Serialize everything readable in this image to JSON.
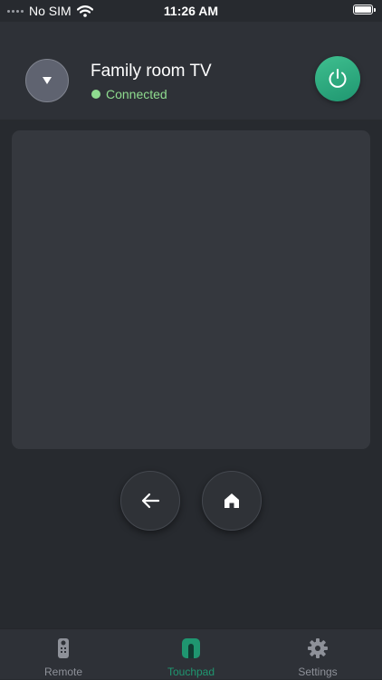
{
  "status_bar": {
    "carrier": "No SIM",
    "time": "11:26 AM"
  },
  "header": {
    "device_name": "Family room TV",
    "connection_status": "Connected"
  },
  "controls": {
    "back_icon": "arrow-left-icon",
    "home_icon": "home-icon"
  },
  "tabs": [
    {
      "label": "Remote",
      "icon": "remote-icon"
    },
    {
      "label": "Touchpad",
      "icon": "touchpad-icon",
      "active": true
    },
    {
      "label": "Settings",
      "icon": "gear-icon"
    }
  ],
  "colors": {
    "background": "#272a2f",
    "header": "#2e3137",
    "touchpad": "#35383e",
    "accent": "#1f9670",
    "connected": "#8fdc8f"
  }
}
